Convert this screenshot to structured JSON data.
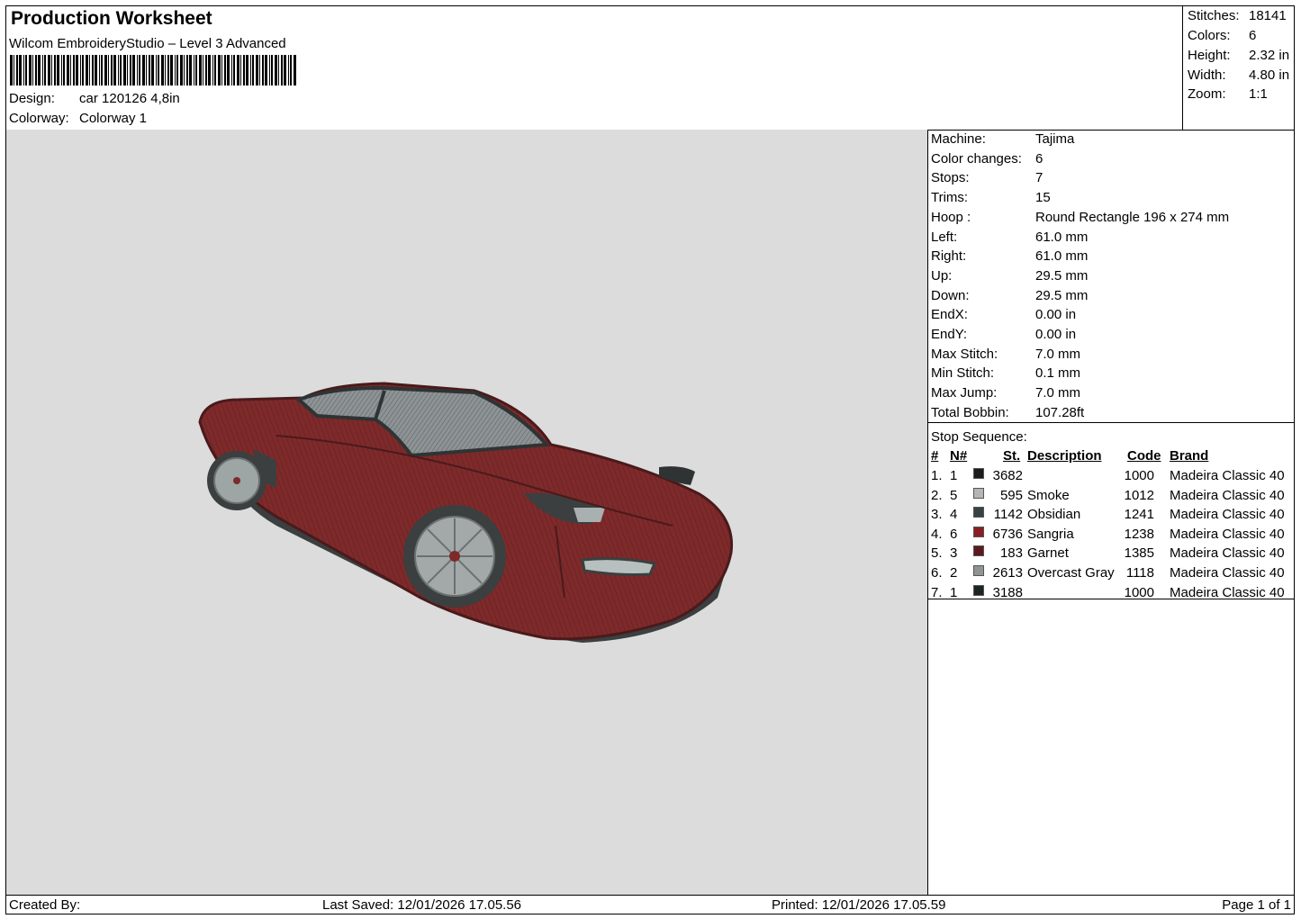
{
  "header": {
    "title": "Production Worksheet",
    "software": "Wilcom EmbroideryStudio – Level 3 Advanced",
    "design_label": "Design:",
    "design_value": "car 120126 4,8in",
    "colorway_label": "Colorway:",
    "colorway_value": "Colorway 1"
  },
  "stats": {
    "stitches_label": "Stitches:",
    "stitches": "18141",
    "colors_label": "Colors:",
    "colors": "6",
    "height_label": "Height:",
    "height": "2.32 in",
    "width_label": "Width:",
    "width": "4.80 in",
    "zoom_label": "Zoom:",
    "zoom": "1:1"
  },
  "machine_info": [
    {
      "label": "Machine:",
      "value": "Tajima"
    },
    {
      "label": "Color changes:",
      "value": "6"
    },
    {
      "label": "Stops:",
      "value": "7"
    },
    {
      "label": "Trims:",
      "value": "15"
    },
    {
      "label": "Hoop :",
      "value": "Round Rectangle 196 x 274 mm"
    },
    {
      "label": "Left:",
      "value": "61.0 mm"
    },
    {
      "label": "Right:",
      "value": "61.0 mm"
    },
    {
      "label": "Up:",
      "value": "29.5 mm"
    },
    {
      "label": "Down:",
      "value": "29.5 mm"
    },
    {
      "label": "EndX:",
      "value": "0.00 in"
    },
    {
      "label": "EndY:",
      "value": "0.00 in"
    },
    {
      "label": "Max Stitch:",
      "value": "7.0 mm"
    },
    {
      "label": "Min Stitch:",
      "value": "0.1 mm"
    },
    {
      "label": "Max Jump:",
      "value": "7.0 mm"
    },
    {
      "label": "Total Bobbin:",
      "value": "107.28ft"
    }
  ],
  "stop_sequence": {
    "title": "Stop Sequence:",
    "headers": {
      "num": "#",
      "n": "N#",
      "st": "St.",
      "desc": "Description",
      "code": "Code",
      "brand": "Brand"
    },
    "rows": [
      {
        "num": "1.",
        "n": "1",
        "color": "#1c1c1c",
        "st": "3682",
        "desc": "",
        "code": "1000",
        "brand": "Madeira Classic 40"
      },
      {
        "num": "2.",
        "n": "5",
        "color": "#b4b6b6",
        "st": "595",
        "desc": "Smoke",
        "code": "1012",
        "brand": "Madeira Classic 40"
      },
      {
        "num": "3.",
        "n": "4",
        "color": "#3a4144",
        "st": "1142",
        "desc": "Obsidian",
        "code": "1241",
        "brand": "Madeira Classic 40"
      },
      {
        "num": "4.",
        "n": "6",
        "color": "#8a1e24",
        "st": "6736",
        "desc": "Sangria",
        "code": "1238",
        "brand": "Madeira Classic 40"
      },
      {
        "num": "5.",
        "n": "3",
        "color": "#5c1a1f",
        "st": "183",
        "desc": "Garnet",
        "code": "1385",
        "brand": "Madeira Classic 40"
      },
      {
        "num": "6.",
        "n": "2",
        "color": "#8f9393",
        "st": "2613",
        "desc": "Overcast Gray",
        "code": "1118",
        "brand": "Madeira Classic 40"
      },
      {
        "num": "7.",
        "n": "1",
        "color": "#1e2424",
        "st": "3188",
        "desc": "",
        "code": "1000",
        "brand": "Madeira Classic 40"
      }
    ]
  },
  "footer": {
    "created_by": "Created By:",
    "last_saved": "Last Saved: 12/01/2026 17.05.56",
    "printed": "Printed: 12/01/2026 17.05.59",
    "page": "Page 1 of 1"
  }
}
